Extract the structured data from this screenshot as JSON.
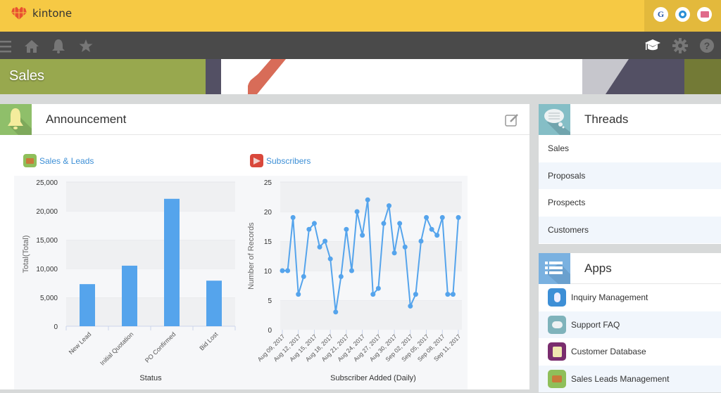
{
  "header": {
    "logo_text": "kintone",
    "buttons": [
      {
        "name": "garoon",
        "glyph": "G",
        "color": "#2b5aa8"
      },
      {
        "name": "office",
        "glyph": "O",
        "color": "#2a8fd6"
      },
      {
        "name": "mail",
        "glyph": "✉",
        "color": "#e06a8a"
      }
    ]
  },
  "navbar": {
    "left_icons": [
      "menu-icon",
      "home-icon",
      "bell-icon",
      "star-icon"
    ],
    "right_icons": [
      "graduation-cap-icon",
      "gear-icon",
      "help-icon"
    ]
  },
  "banner": {
    "title": "Sales"
  },
  "announcement": {
    "title": "Announcement",
    "charts": [
      {
        "link_label": "Sales & Leads"
      },
      {
        "link_label": "Subscribers"
      }
    ]
  },
  "threads": {
    "title": "Threads",
    "items": [
      "Sales",
      "Proposals",
      "Prospects",
      "Customers"
    ]
  },
  "apps": {
    "title": "Apps",
    "items": [
      {
        "label": "Inquiry Management",
        "color": "#3d8fd6"
      },
      {
        "label": "Support FAQ",
        "color": "#7fb3bb"
      },
      {
        "label": "Customer Database",
        "color": "#7a2d6e"
      },
      {
        "label": "Sales Leads Management",
        "color": "#8fbf5a"
      }
    ]
  },
  "colors": {
    "accent": "#f6c944",
    "bar": "#55a4ec",
    "banner_green": "#98a84e"
  },
  "chart_data": [
    {
      "type": "bar",
      "title": "Sales & Leads",
      "categories": [
        "New Lead",
        "Initial Quotation",
        "PO Confirmed",
        "Bid Lost"
      ],
      "values": [
        7300,
        10500,
        22100,
        7900
      ],
      "xlabel": "Status",
      "ylabel": "Total(Total)",
      "ylim": [
        0,
        25000
      ],
      "yticks": [
        0,
        5000,
        10000,
        15000,
        20000,
        25000
      ],
      "ytick_labels": [
        "0",
        "5,000",
        "10,000",
        "15,000",
        "20,000",
        "25,000"
      ],
      "grid": true
    },
    {
      "type": "line",
      "title": "Subscribers",
      "xlabel": "Subscriber Added (Daily)",
      "ylabel": "Number of Records",
      "ylim": [
        0,
        25
      ],
      "yticks": [
        0,
        5,
        10,
        15,
        20,
        25
      ],
      "x_tick_labels": [
        "Aug 09, 2017",
        "Aug 12, 2017",
        "Aug 15, 2017",
        "Aug 18, 2017",
        "Aug 21, 2017",
        "Aug 24, 2017",
        "Aug 27, 2017",
        "Aug 30, 2017",
        "Sep 02, 2017",
        "Sep 05, 2017",
        "Sep 08, 2017",
        "Sep 11, 2017"
      ],
      "x_start": "Aug 09, 2017",
      "x_end": "Sep 11, 2017",
      "values": [
        10,
        10,
        19,
        6,
        9,
        17,
        18,
        14,
        15,
        12,
        3,
        9,
        17,
        10,
        20,
        16,
        22,
        6,
        7,
        18,
        21,
        13,
        18,
        14,
        4,
        6,
        15,
        19,
        17,
        16,
        19,
        6,
        6,
        19
      ],
      "grid": true
    }
  ]
}
